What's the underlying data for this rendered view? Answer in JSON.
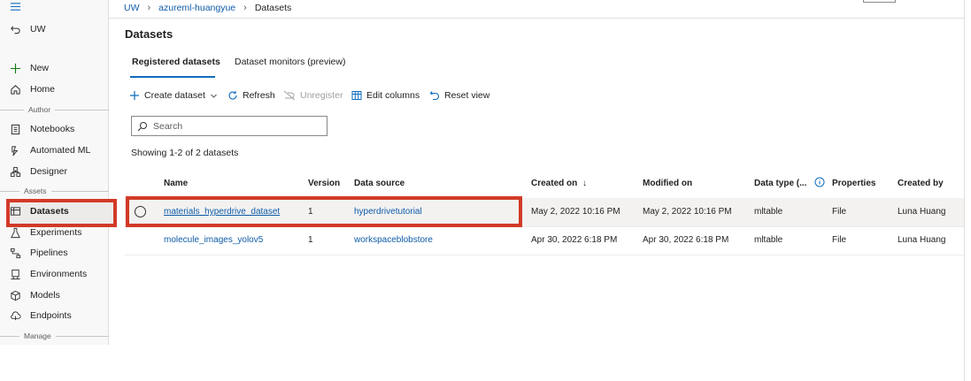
{
  "sidebar": {
    "collapse_label": "",
    "back_label": "UW",
    "items": [
      {
        "label": "New",
        "icon": "plus-icon"
      },
      {
        "label": "Home",
        "icon": "home-icon"
      },
      {
        "label": "Notebooks",
        "icon": "notebook-icon"
      },
      {
        "label": "Automated ML",
        "icon": "automated-ml-icon"
      },
      {
        "label": "Designer",
        "icon": "designer-icon"
      },
      {
        "label": "Datasets",
        "icon": "datasets-icon"
      },
      {
        "label": "Experiments",
        "icon": "flask-icon"
      },
      {
        "label": "Pipelines",
        "icon": "pipelines-icon"
      },
      {
        "label": "Environments",
        "icon": "environments-icon"
      },
      {
        "label": "Models",
        "icon": "cube-icon"
      },
      {
        "label": "Endpoints",
        "icon": "cloud-endpoint-icon"
      }
    ],
    "sections": {
      "author": "Author",
      "assets": "Assets",
      "manage": "Manage"
    }
  },
  "breadcrumb": {
    "org": "UW",
    "workspace": "azureml-huangyue",
    "current": "Datasets"
  },
  "page": {
    "title": "Datasets"
  },
  "tabs": [
    {
      "label": "Registered datasets",
      "active": true
    },
    {
      "label": "Dataset monitors (preview)",
      "active": false
    }
  ],
  "toolbar": {
    "create": "Create dataset",
    "refresh": "Refresh",
    "unregister": "Unregister",
    "edit_columns": "Edit columns",
    "reset_view": "Reset view"
  },
  "search": {
    "placeholder": "Search"
  },
  "showing": "Showing 1-2 of 2 datasets",
  "table": {
    "columns": {
      "name": "Name",
      "version": "Version",
      "source": "Data source",
      "created": "Created on",
      "modified": "Modified on",
      "datatype": "Data type (...",
      "properties": "Properties",
      "createdby": "Created by"
    },
    "rows": [
      {
        "name": "materials_hyperdrive_dataset",
        "version": "1",
        "source": "hyperdrivetutorial",
        "created": "May 2, 2022 10:16 PM",
        "modified": "May 2, 2022 10:16 PM",
        "datatype": "mltable",
        "properties": "File",
        "createdby": "Luna Huang"
      },
      {
        "name": "molecule_images_yolov5",
        "version": "1",
        "source": "workspaceblobstore",
        "created": "Apr 30, 2022 6:18 PM",
        "modified": "Apr 30, 2022 6:18 PM",
        "datatype": "mltable",
        "properties": "File",
        "createdby": "Luna Huang"
      }
    ]
  },
  "colors": {
    "accent": "#0f6cbd",
    "link": "#0f5ca8",
    "highlight": "#d23a27"
  }
}
